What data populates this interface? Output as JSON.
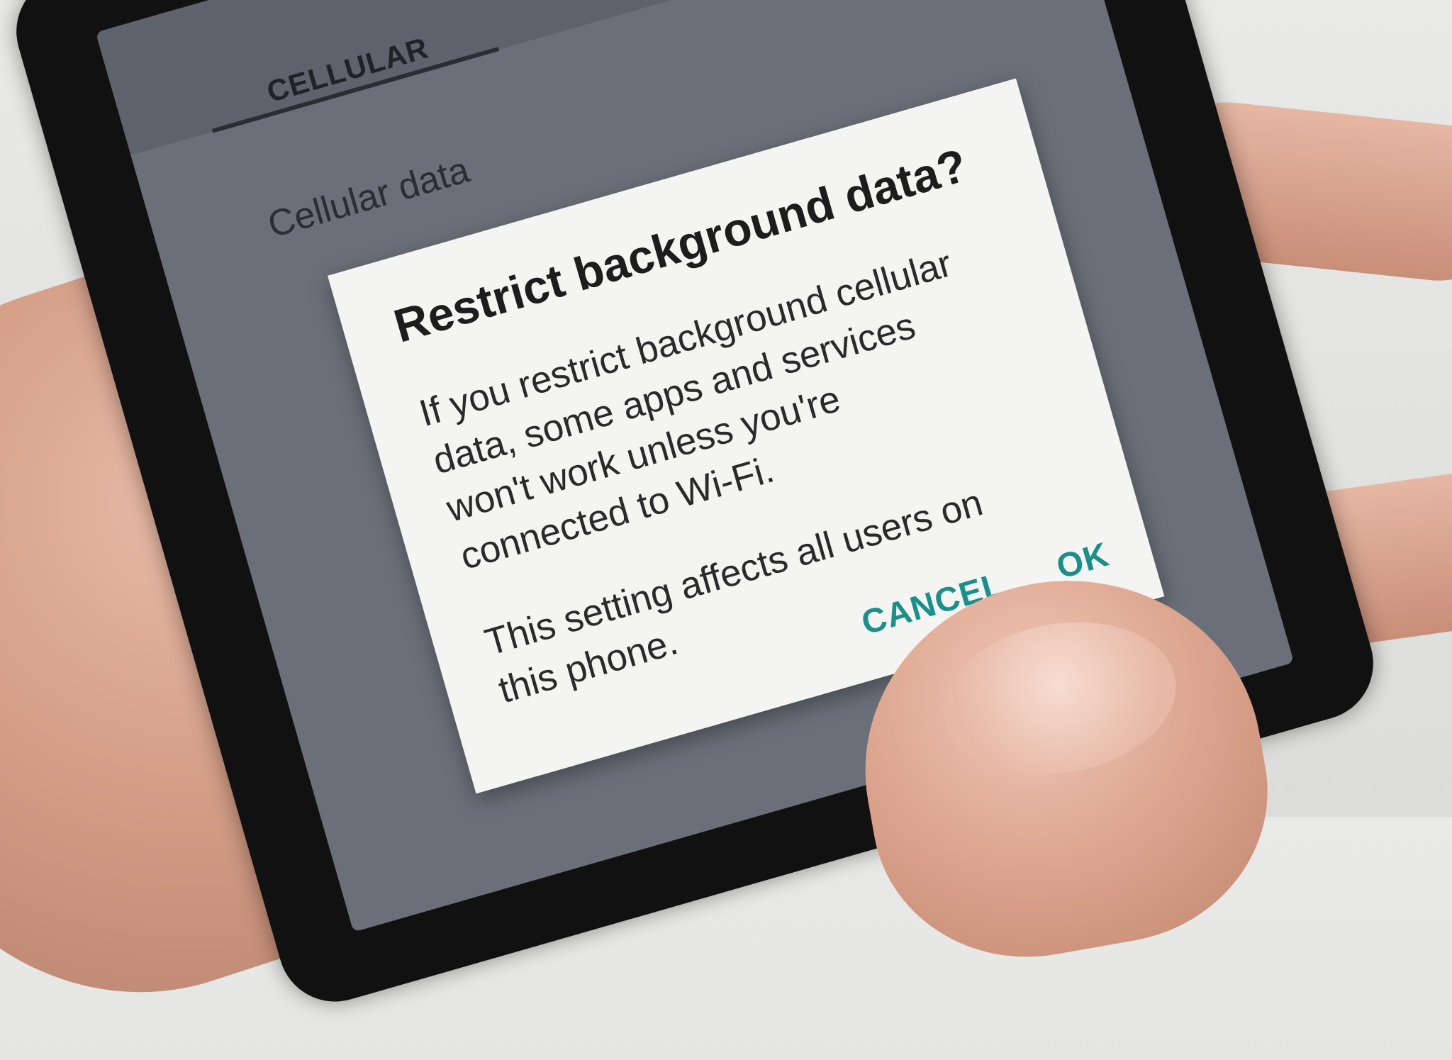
{
  "screen": {
    "tab_label": "CELLULAR",
    "row_title": "Cellular data"
  },
  "dialog": {
    "title": "Restrict background data?",
    "body": [
      "If you restrict background cellular data, some apps and services won't work unless you're connected to Wi-Fi.",
      "This setting affects all users on this phone."
    ],
    "cancel_label": "CANCEL",
    "ok_label": "OK"
  },
  "colors": {
    "accent": "#1b8f8a",
    "dialog_background": "#f4f4f3",
    "scrim": "#6a6f79"
  }
}
